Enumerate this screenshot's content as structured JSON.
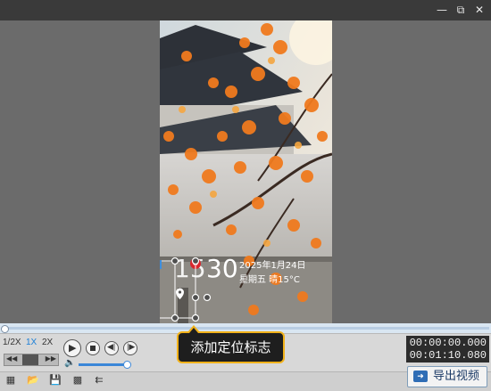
{
  "window": {
    "minimize_icon": "minimize-icon",
    "restore_icon": "restore-icon",
    "close_icon": "close-icon"
  },
  "overlay": {
    "time_text": "30",
    "time_prefix": "15",
    "date_text": "2025年1月24日",
    "weather_text": "星期五 晴15°C"
  },
  "tooltip": {
    "text": "添加定位标志"
  },
  "playback": {
    "speed_options": [
      "1/2X",
      "1X",
      "2X"
    ],
    "selected_speed": "1X"
  },
  "time": {
    "current": "00:00:00.000",
    "total": "00:01:10.080"
  },
  "export": {
    "label": "导出视频"
  },
  "colors": {
    "accent": "#f2b21a",
    "leaf": "#f07a1e",
    "link": "#1b3a66"
  }
}
